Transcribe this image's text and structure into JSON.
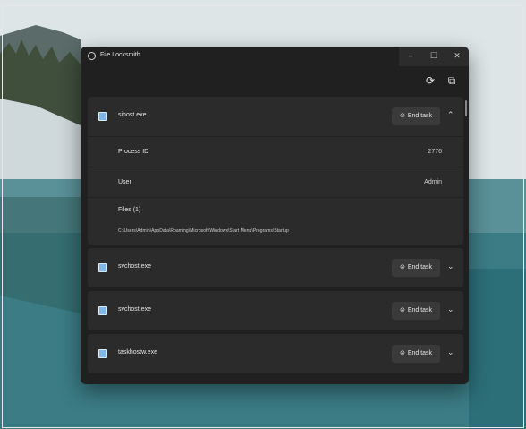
{
  "window": {
    "title": "File Locksmith",
    "min": "–",
    "max": "☐",
    "close": "✕"
  },
  "toolbar": {
    "refresh": "⟳",
    "filter": "⧉"
  },
  "processes": [
    {
      "name": "sihost.exe",
      "end_label": "End task",
      "expanded": true,
      "details": {
        "pid_label": "Process ID",
        "pid": "2776",
        "user_label": "User",
        "user": "Admin",
        "files_label": "Files (1)",
        "file_path": "C:\\Users\\Admin\\AppData\\Roaming\\Microsoft\\Windows\\Start Menu\\Programs\\Startup"
      }
    },
    {
      "name": "svchost.exe",
      "end_label": "End task",
      "expanded": false
    },
    {
      "name": "svchost.exe",
      "end_label": "End task",
      "expanded": false
    },
    {
      "name": "taskhostw.exe",
      "end_label": "End task",
      "expanded": false
    }
  ]
}
